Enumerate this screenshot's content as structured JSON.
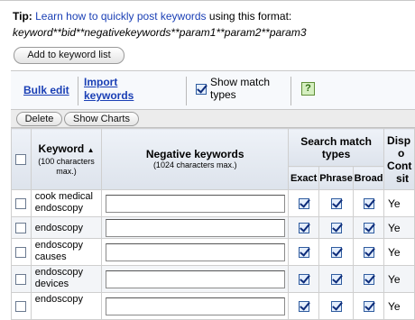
{
  "tip": {
    "label": "Tip:",
    "link": "Learn how to quickly post keywords",
    "suffix": " using this format:",
    "format": "keyword**bid**negativekeywords**param1**param2**param3"
  },
  "add_button": "Add to keyword list",
  "toolbar": {
    "bulk_edit": "Bulk edit",
    "import_line1": "Import",
    "import_line2": "keywords",
    "show_match_types_line1": "Show match",
    "show_match_types_line2": "types",
    "show_match_types_checked": true,
    "help": "?"
  },
  "actions": {
    "delete": "Delete",
    "show_charts": "Show Charts"
  },
  "table": {
    "headers": {
      "keyword": "Keyword",
      "keyword_sort_arrow": "▲",
      "keyword_sub": "(100 characters max.)",
      "negative": "Negative keywords",
      "negative_sub": "(1024 characters max.)",
      "search_match_line1": "Search match",
      "search_match_line2": "types",
      "exact": "Exact",
      "phrase": "Phrase",
      "broad": "Broad",
      "display_line1": "Disp",
      "display_line2": "o",
      "display_line3": "Cont",
      "display_line4": "sit"
    },
    "rows": [
      {
        "keyword_line1": "cook medical",
        "keyword_line2": "endoscopy",
        "negative": "",
        "exact": true,
        "phrase": true,
        "broad": true,
        "display": "Ye"
      },
      {
        "keyword_line1": "endoscopy",
        "keyword_line2": "",
        "negative": "",
        "exact": true,
        "phrase": true,
        "broad": true,
        "display": "Ye"
      },
      {
        "keyword_line1": "endoscopy",
        "keyword_line2": "causes",
        "negative": "",
        "exact": true,
        "phrase": true,
        "broad": true,
        "display": "Ye"
      },
      {
        "keyword_line1": "endoscopy",
        "keyword_line2": "devices",
        "negative": "",
        "exact": true,
        "phrase": true,
        "broad": true,
        "display": "Ye"
      },
      {
        "keyword_line1": "endoscopy",
        "keyword_line2": "",
        "negative": "",
        "exact": true,
        "phrase": true,
        "broad": true,
        "display": "Ye"
      }
    ]
  }
}
